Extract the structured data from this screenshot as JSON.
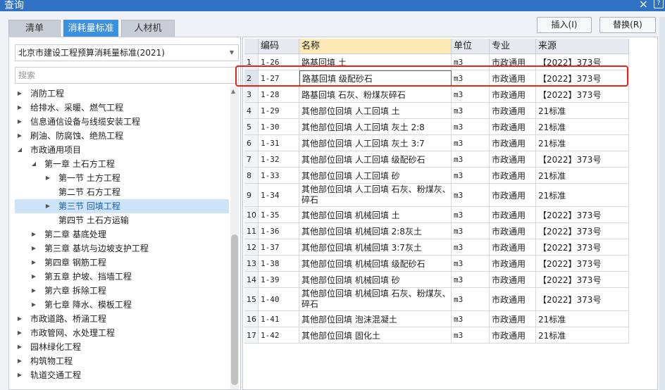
{
  "window": {
    "title": "查询",
    "close_glyph": "×",
    "help_glyph": "?"
  },
  "tabs": [
    "清单",
    "消耗量标准",
    "人材机"
  ],
  "actions": {
    "insert": "插入(I)",
    "replace": "替换(R)"
  },
  "standard_select": {
    "value": "北京市建设工程预算消耗量标准(2021)"
  },
  "search": {
    "placeholder": "搜索"
  },
  "tree": [
    {
      "label": "消防工程",
      "expand": "▶"
    },
    {
      "label": "给排水、采暖、燃气工程",
      "expand": "▶"
    },
    {
      "label": "信息通信设备与线缆安装工程",
      "expand": "▶"
    },
    {
      "label": "刷油、防腐蚀、绝热工程",
      "expand": "▶"
    },
    {
      "label": "市政通用项目",
      "expand": "◢"
    },
    {
      "label": "第一章 土石方工程",
      "expand": "◢"
    },
    {
      "label": "第一节 土方工程",
      "expand": "▶"
    },
    {
      "label": "第二节 石方工程",
      "expand": ""
    },
    {
      "label": "第三节 回填工程",
      "expand": "▶"
    },
    {
      "label": "第四节 土石方运输",
      "expand": ""
    },
    {
      "label": "第二章 基底处理",
      "expand": "▶"
    },
    {
      "label": "第三章 基坑与边坡支护工程",
      "expand": "▶"
    },
    {
      "label": "第四章 钢筋工程",
      "expand": "▶"
    },
    {
      "label": "第五章 护坡、挡墙工程",
      "expand": "▶"
    },
    {
      "label": "第六章 拆除工程",
      "expand": "▶"
    },
    {
      "label": "第七章 降水、模板工程",
      "expand": "▶"
    },
    {
      "label": "市政道路、桥涵工程",
      "expand": "▶"
    },
    {
      "label": "市政管网、水处理工程",
      "expand": "▶"
    },
    {
      "label": "园林绿化工程",
      "expand": "▶"
    },
    {
      "label": "构筑物工程",
      "expand": "▶"
    },
    {
      "label": "轨道交通工程",
      "expand": "▶"
    }
  ],
  "table": {
    "headers": [
      "",
      "编码",
      "名称",
      "单位",
      "专业",
      "来源"
    ],
    "rows": [
      [
        "1",
        "1-26",
        "路基回填 土",
        "m3",
        "市政通用",
        "【2022】373号"
      ],
      [
        "2",
        "1-27",
        "路基回填 级配砂石",
        "m3",
        "市政通用",
        "【2022】373号"
      ],
      [
        "3",
        "1-28",
        "路基回填 石灰、粉煤灰碎石",
        "m3",
        "市政通用",
        "【2022】373号"
      ],
      [
        "4",
        "1-29",
        "其他部位回填 人工回填 土",
        "m3",
        "市政通用",
        "21标准"
      ],
      [
        "5",
        "1-30",
        "其他部位回填 人工回填 灰土 2:8",
        "m3",
        "市政通用",
        "21标准"
      ],
      [
        "6",
        "1-31",
        "其他部位回填 人工回填 灰土 3:7",
        "m3",
        "市政通用",
        "21标准"
      ],
      [
        "7",
        "1-32",
        "其他部位回填 人工回填 级配砂石",
        "m3",
        "市政通用",
        "【2022】373号"
      ],
      [
        "8",
        "1-33",
        "其他部位回填 人工回填 砂",
        "m3",
        "市政通用",
        "21标准"
      ],
      [
        "9",
        "1-34",
        "其他部位回填 人工回填 石灰、粉煤灰、碎石",
        "m3",
        "市政通用",
        "21标准"
      ],
      [
        "10",
        "1-35",
        "其他部位回填 机械回填 土",
        "m3",
        "市政通用",
        "【2022】373号"
      ],
      [
        "11",
        "1-36",
        "其他部位回填 机械回填 2:8灰土",
        "m3",
        "市政通用",
        "【2022】373号"
      ],
      [
        "12",
        "1-37",
        "其他部位回填 机械回填 3:7灰土",
        "m3",
        "市政通用",
        "【2022】373号"
      ],
      [
        "13",
        "1-38",
        "其他部位回填 机械回填 级配砂石",
        "m3",
        "市政通用",
        "【2022】373号"
      ],
      [
        "14",
        "1-39",
        "其他部位回填 机械回填 砂",
        "m3",
        "市政通用",
        "【2022】373号"
      ],
      [
        "15",
        "1-40",
        "其他部位回填 机械回填 石灰、粉煤灰、碎石",
        "m3",
        "市政通用",
        "【2022】373号"
      ],
      [
        "16",
        "1-41",
        "其他部位回填 泡沫混凝土",
        "m3",
        "市政通用",
        "21标准"
      ],
      [
        "17",
        "1-42",
        "其他部位回填 固化土",
        "m3",
        "市政通用",
        "21标准"
      ]
    ]
  }
}
